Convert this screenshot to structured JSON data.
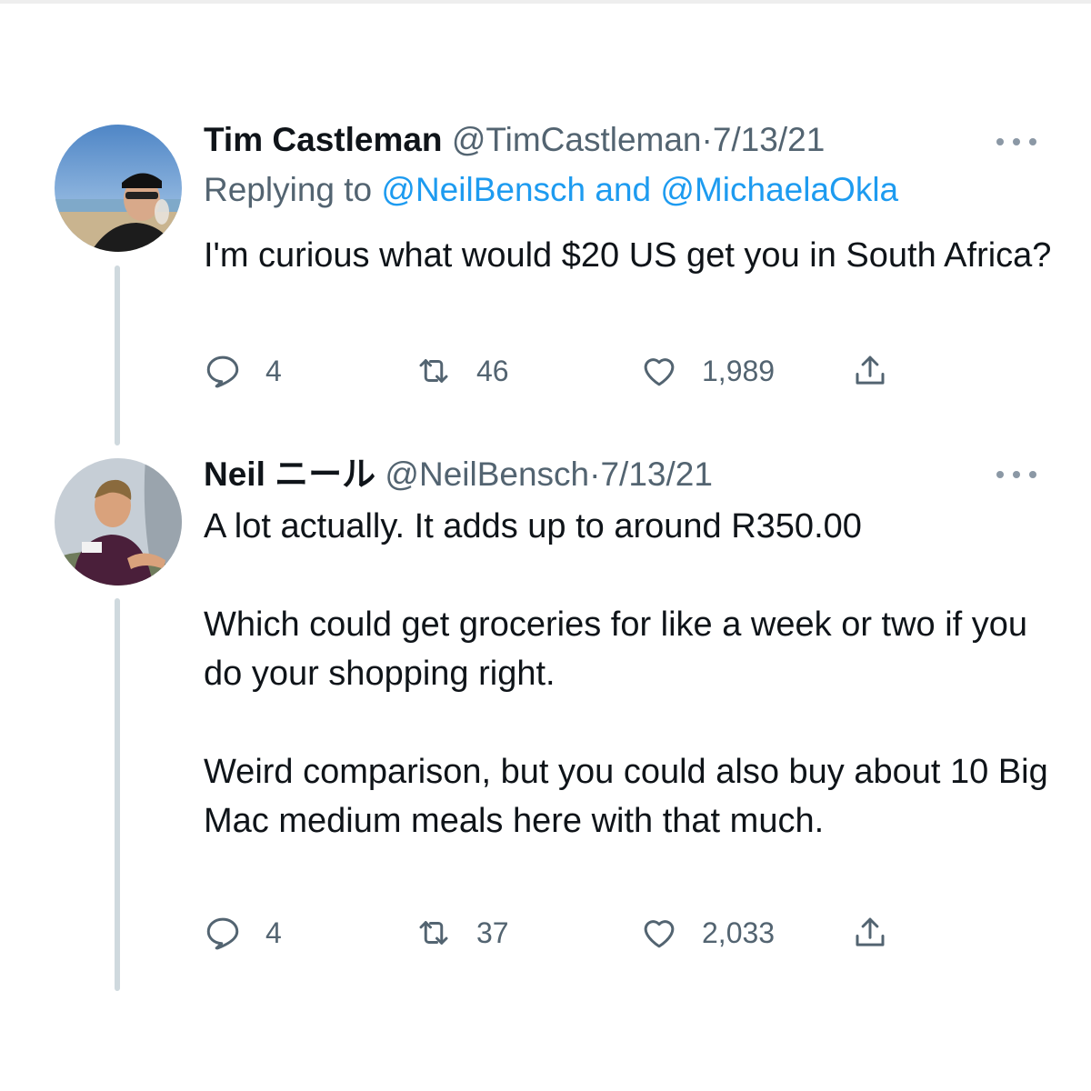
{
  "tweets": [
    {
      "name": "Tim Castleman",
      "handle": "@TimCastleman",
      "separator": "·",
      "date": "7/13/21",
      "replying_prefix": "Replying to",
      "replying_mention_1": "@NeilBensch",
      "replying_conjunction": "and",
      "replying_mention_2": "@MichaelaOkla",
      "paragraphs": [
        "I'm curious what would $20 US get you in South Africa?"
      ],
      "counts": {
        "replies": "4",
        "retweets": "46",
        "likes": "1,989"
      }
    },
    {
      "name": "Neil ニール",
      "handle": "@NeilBensch",
      "separator": "·",
      "date": "7/13/21",
      "paragraphs": [
        "A lot actually. It adds up to around R350.00",
        "Which could get groceries for like a week or two if you do your shopping right.",
        "Weird comparison, but you could also buy about 10 Big Mac medium meals here with that much."
      ],
      "counts": {
        "replies": "4",
        "retweets": "37",
        "likes": "2,033"
      }
    }
  ],
  "icons": {
    "reply": "speech-bubble-icon",
    "retweet": "retweet-icon",
    "like": "heart-icon",
    "share": "share-icon",
    "more": "more-dots-icon"
  },
  "colors": {
    "text": "#0f1419",
    "secondary": "#536471",
    "mention": "#1d9bf0",
    "thread_line": "#cfd9de"
  }
}
